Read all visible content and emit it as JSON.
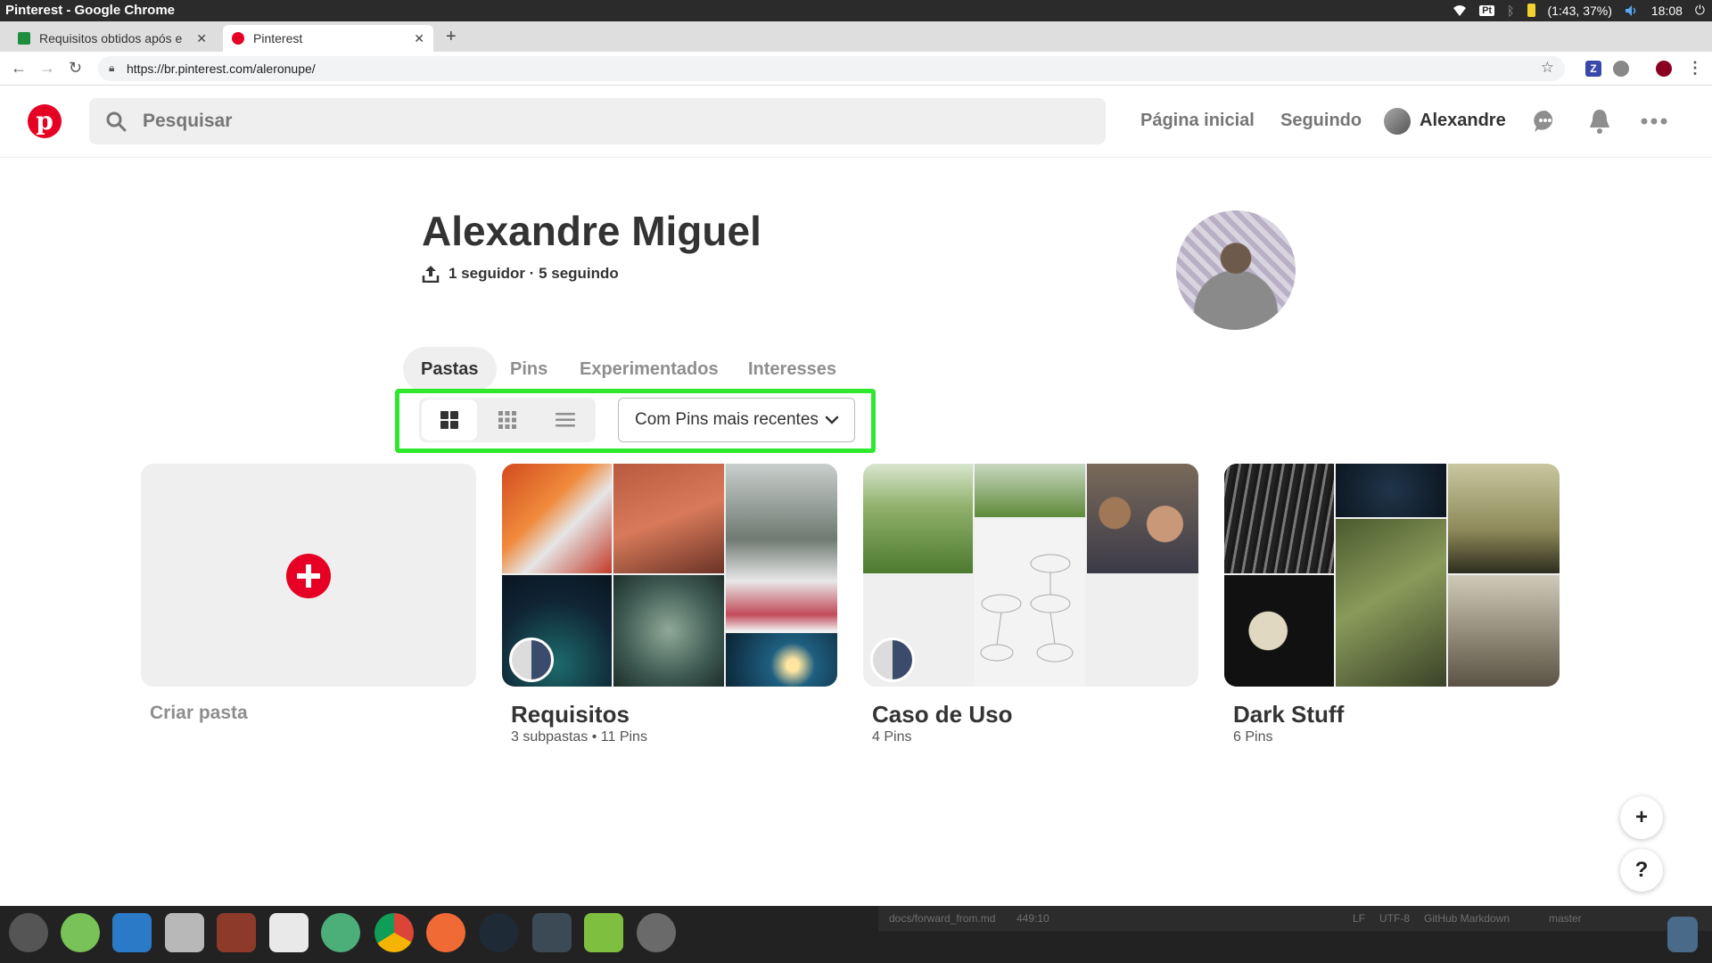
{
  "os": {
    "window_title": "Pinterest - Google Chrome",
    "lang": "Pt",
    "battery": "(1:43, 37%)",
    "clock": "18:08"
  },
  "browser": {
    "tabs": [
      {
        "label": "Requisitos obtidos após e",
        "active": false
      },
      {
        "label": "Pinterest",
        "active": true
      }
    ],
    "new_tab": "+",
    "url": "https://br.pinterest.com/aleronupe/"
  },
  "header": {
    "logo": "p",
    "search_placeholder": "Pesquisar",
    "nav": {
      "home": "Página inicial",
      "following": "Seguindo",
      "user": "Alexandre"
    }
  },
  "profile": {
    "name": "Alexandre Miguel",
    "followers": "1 seguidor · 5 seguindo"
  },
  "tabs": [
    "Pastas",
    "Pins",
    "Experimentados",
    "Interesses"
  ],
  "active_tab": "Pastas",
  "toolbar": {
    "view_options": [
      "grid-large",
      "grid-small",
      "list"
    ],
    "selected_view": "grid-large",
    "sort_label": "Com Pins mais recentes"
  },
  "create_board": {
    "label": "Criar pasta"
  },
  "boards": [
    {
      "title": "Requisitos",
      "subtitle": "3 subpastas • 11 Pins"
    },
    {
      "title": "Caso de Uso",
      "subtitle": "4 Pins"
    },
    {
      "title": "Dark Stuff",
      "subtitle": "6 Pins"
    }
  ],
  "fab": {
    "add": "+",
    "help": "?"
  },
  "statusbar": {
    "file": "docs/forward_from.md",
    "pos": "449:10",
    "eol": "LF",
    "enc": "UTF-8",
    "grammar": "GitHub Markdown",
    "branch": "master"
  },
  "colors": {
    "brand": "#e60023",
    "highlight": "#2ee82e"
  }
}
